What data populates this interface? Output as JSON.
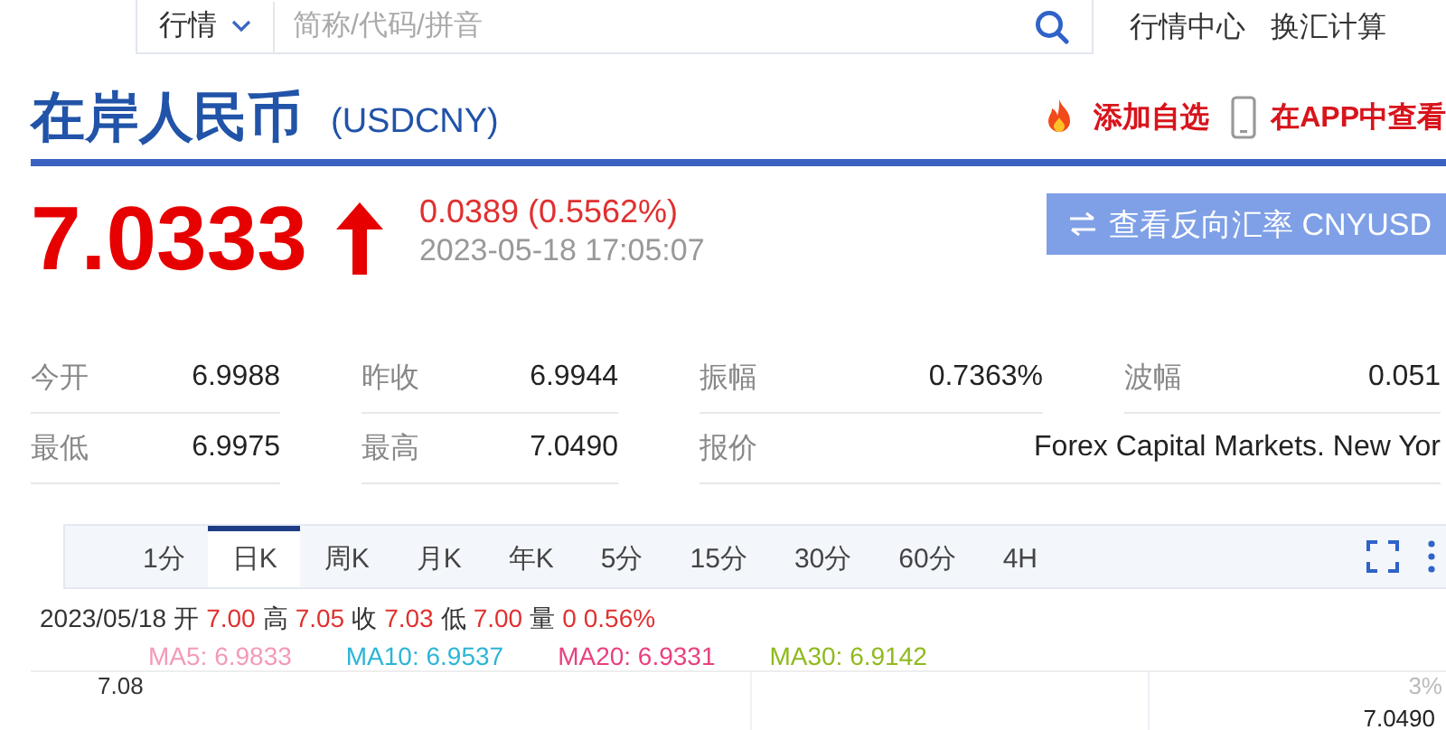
{
  "search": {
    "category": "行情",
    "placeholder": "简称/代码/拼音"
  },
  "nav_links": [
    "行情中心",
    "换汇计算"
  ],
  "title": {
    "name": "在岸人民币",
    "code": "(USDCNY)"
  },
  "actions": [
    {
      "kind": "fire",
      "label": "添加自选"
    },
    {
      "kind": "phone",
      "label": "在APP中查看"
    }
  ],
  "quote": {
    "price": "7.0333",
    "up": true,
    "change": "0.0389 (0.5562%)",
    "time": "2023-05-18 17:05:07"
  },
  "reverse_button": "查看反向汇率 CNYUSD",
  "stats": [
    [
      {
        "label": "今开",
        "value": "6.9988"
      },
      {
        "label": "昨收",
        "value": "6.9944"
      },
      {
        "label": "振幅",
        "value": "0.7363%"
      },
      {
        "label": "波幅",
        "value": "0.051"
      }
    ],
    [
      {
        "label": "最低",
        "value": "6.9975"
      },
      {
        "label": "最高",
        "value": "7.0490"
      },
      {
        "label": "报价",
        "value": "Forex Capital Markets. New Yor",
        "wide": true
      }
    ]
  ],
  "chart_tabs": [
    {
      "label": "1分",
      "selected": false
    },
    {
      "label": "日K",
      "selected": true
    },
    {
      "label": "周K",
      "selected": false
    },
    {
      "label": "月K",
      "selected": false
    },
    {
      "label": "年K",
      "selected": false
    },
    {
      "label": "5分",
      "selected": false
    },
    {
      "label": "15分",
      "selected": false
    },
    {
      "label": "30分",
      "selected": false
    },
    {
      "label": "60分",
      "selected": false
    },
    {
      "label": "4H",
      "selected": false
    }
  ],
  "ohlc": {
    "date": "2023/05/18",
    "items": [
      {
        "label": "开",
        "value": "7.00"
      },
      {
        "label": "高",
        "value": "7.05"
      },
      {
        "label": "收",
        "value": "7.03"
      },
      {
        "label": "低",
        "value": "7.00"
      },
      {
        "label": "量",
        "value": "0"
      }
    ],
    "change": "0.56%"
  },
  "moving_averages": [
    {
      "label": "MA5: 6.9833",
      "color": "#f29ab9"
    },
    {
      "label": "MA10: 6.9537",
      "color": "#2cb5d6"
    },
    {
      "label": "MA20: 6.9331",
      "color": "#e8417f"
    },
    {
      "label": "MA30: 6.9142",
      "color": "#8fba1c"
    }
  ],
  "chart": {
    "y_label": "7.08",
    "percent_label": "3%",
    "last_price": "7.0490"
  }
}
